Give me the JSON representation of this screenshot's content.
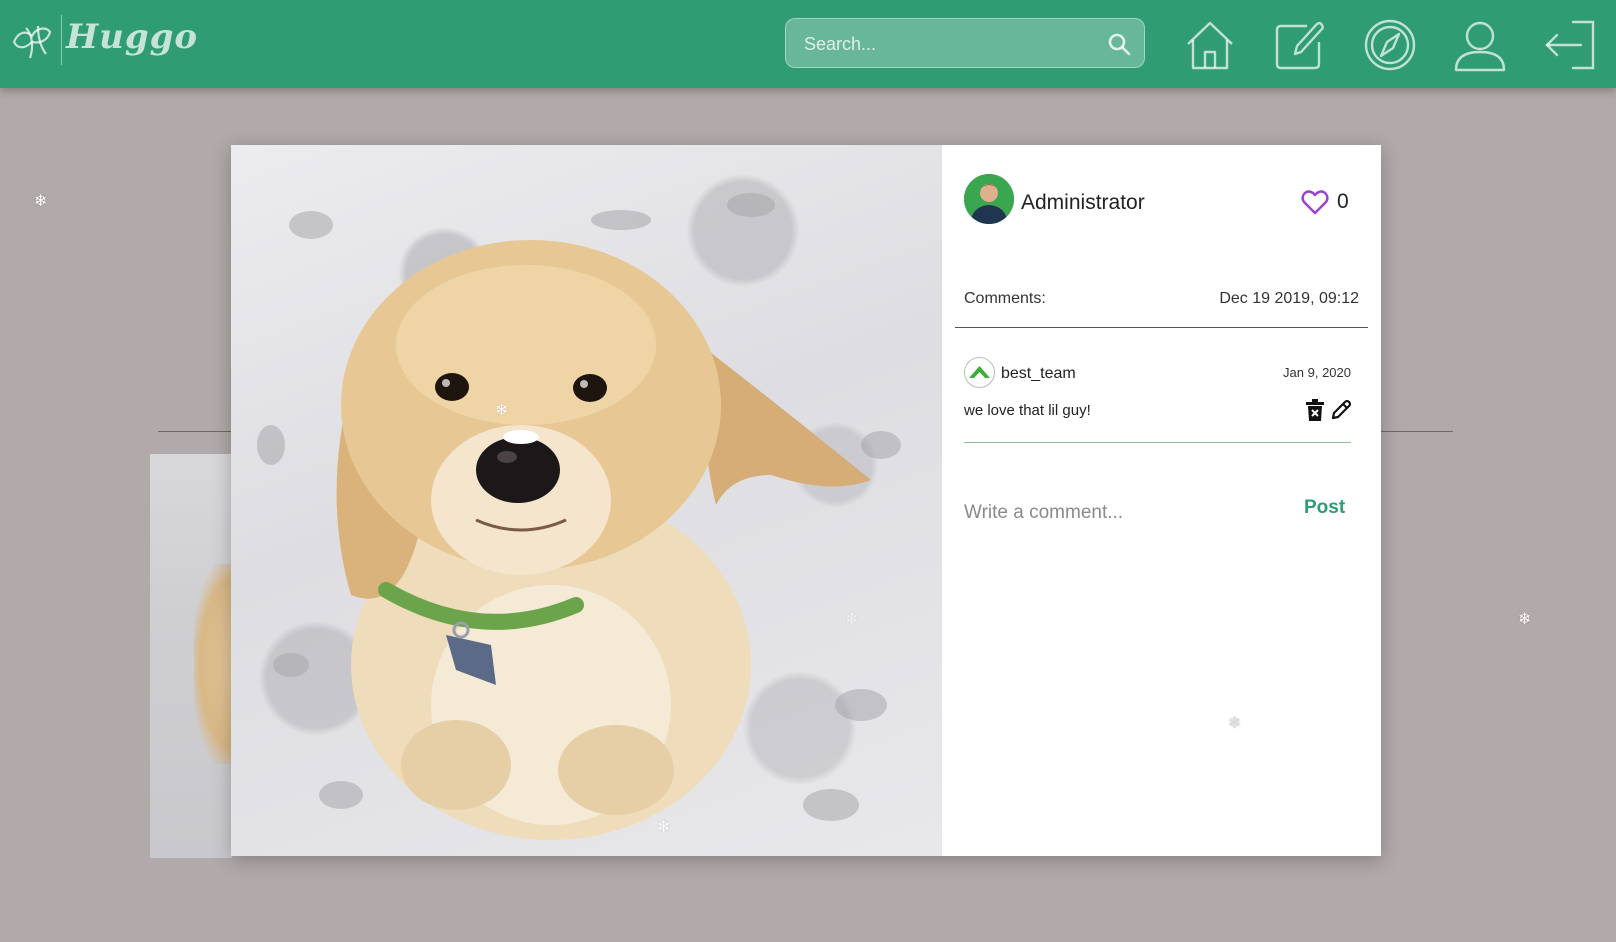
{
  "brand": {
    "name": "Huggo"
  },
  "search": {
    "placeholder": "Search..."
  },
  "nav": {
    "items": [
      {
        "name": "home",
        "icon": "home-icon"
      },
      {
        "name": "new-post",
        "icon": "edit-icon"
      },
      {
        "name": "explore",
        "icon": "compass-icon"
      },
      {
        "name": "profile",
        "icon": "user-icon"
      },
      {
        "name": "logout",
        "icon": "logout-icon"
      }
    ]
  },
  "post": {
    "author": "Administrator",
    "likes": "0",
    "comments_label": "Comments:",
    "date": "Dec 19 2019, 09:12",
    "comments": [
      {
        "user": "best_team",
        "date": "Jan 9, 2020",
        "text": "we love that lil guy!"
      }
    ],
    "comment_placeholder": "Write a comment...",
    "post_label": "Post"
  },
  "colors": {
    "navbar": "#2f9c73",
    "page_background": "#b1a9aa",
    "like_heart": "#9b3fd1",
    "accent": "#2f9c73"
  },
  "snowflake_glyph": "❄"
}
